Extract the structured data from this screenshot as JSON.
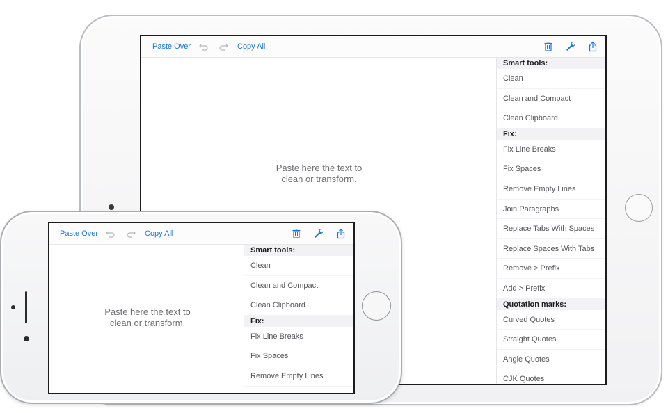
{
  "toolbar": {
    "paste_over": "Paste Over",
    "undo_icon": "undo-icon",
    "redo_icon": "redo-icon",
    "copy_all": "Copy All",
    "trash_icon": "trash-icon",
    "wrench_icon": "wrench-icon",
    "share_icon": "share-icon",
    "accent_color": "#1a73e8"
  },
  "editor": {
    "placeholder_line1": "Paste here the text to",
    "placeholder_line2": "clean or transform."
  },
  "panel": {
    "sections": [
      {
        "header": "Smart tools:",
        "items": [
          "Clean",
          "Clean and Compact",
          "Clean Clipboard"
        ]
      },
      {
        "header": "Fix:",
        "items": [
          "Fix Line Breaks",
          "Fix Spaces",
          "Remove Empty Lines",
          "Join Paragraphs",
          "Replace Tabs With Spaces",
          "Replace Spaces With Tabs",
          "Remove > Prefix",
          "Add > Prefix"
        ]
      },
      {
        "header": "Quotation marks:",
        "items": [
          "Curved Quotes",
          "Straight Quotes",
          "Angle Quotes",
          "CJK Quotes"
        ]
      }
    ]
  }
}
